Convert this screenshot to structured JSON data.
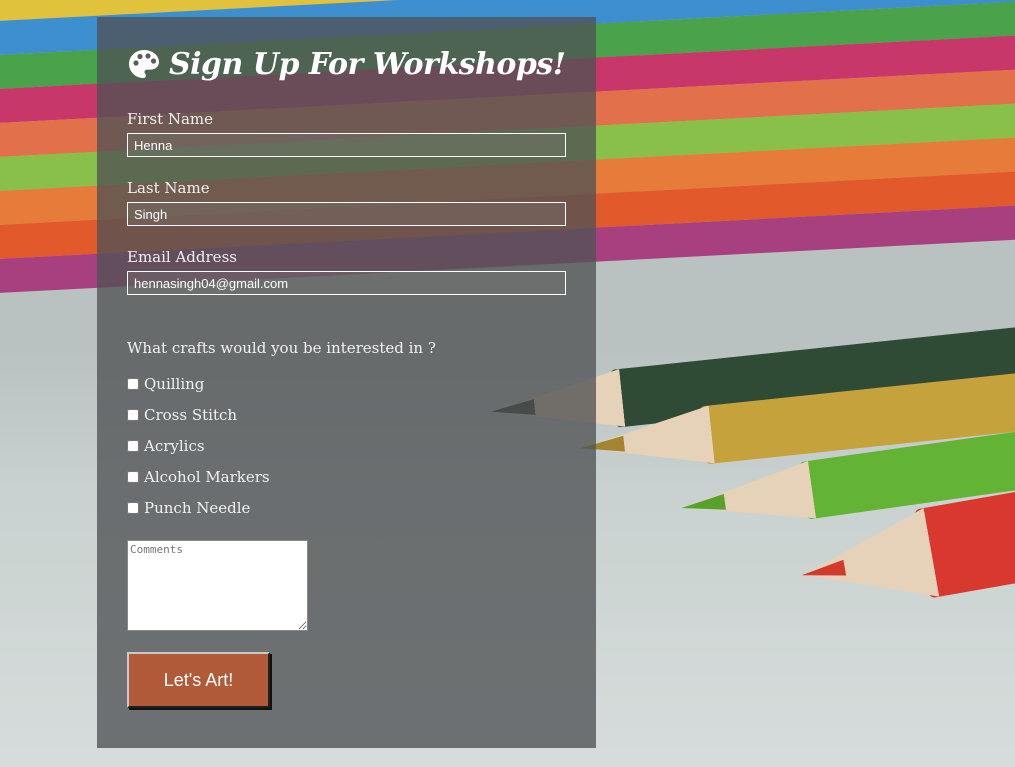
{
  "form": {
    "title": "Sign Up For Workshops!",
    "title_icon": "palette-icon",
    "fields": {
      "first_name": {
        "label": "First Name",
        "value": "Henna"
      },
      "last_name": {
        "label": "Last Name",
        "value": "Singh"
      },
      "email": {
        "label": "Email Address",
        "value": "hennasingh04@gmail.com"
      }
    },
    "question": "What crafts would you be interested in ?",
    "crafts": [
      {
        "label": "Quilling",
        "checked": false
      },
      {
        "label": "Cross Stitch",
        "checked": false
      },
      {
        "label": "Acrylics",
        "checked": false
      },
      {
        "label": "Alcohol Markers",
        "checked": false
      },
      {
        "label": "Punch Needle",
        "checked": false
      }
    ],
    "comments": {
      "placeholder": "Comments",
      "value": ""
    },
    "submit_label": "Let's Art!"
  },
  "colors": {
    "panel": "#505254",
    "button": "#b05a37",
    "text": "#ffffff"
  }
}
